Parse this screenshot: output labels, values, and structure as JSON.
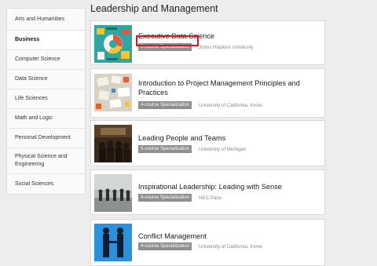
{
  "page": {
    "title": "Leadership and Management"
  },
  "sidebar": {
    "items": [
      {
        "label": "Arts and Humanities",
        "active": false
      },
      {
        "label": "Business",
        "active": true
      },
      {
        "label": "Computer Science",
        "active": false
      },
      {
        "label": "Data Science",
        "active": false
      },
      {
        "label": "Life Sciences",
        "active": false
      },
      {
        "label": "Math and Logic",
        "active": false
      },
      {
        "label": "Personal Development",
        "active": false
      },
      {
        "label": "Physical Science and Engineering",
        "active": false
      },
      {
        "label": "Social Sciences",
        "active": false
      }
    ]
  },
  "courses": [
    {
      "title": "Executive Data Science",
      "badge": "5-course Specialization",
      "partner": "Johns Hopkins University",
      "highlighted": true
    },
    {
      "title": "Introduction to Project Management Principles and Practices",
      "badge": "4-course Specialization",
      "partner": "University of California, Irvine"
    },
    {
      "title": "Leading People and Teams",
      "badge": "5-course Specialization",
      "partner": "University of Michigan"
    },
    {
      "title": "Inspirational Leadership: Leading with Sense",
      "badge": "4-course Specialization",
      "partner": "HEC Paris"
    },
    {
      "title": "Conflict Management",
      "badge": "4-course Specialization",
      "partner": "University of California, Irvine"
    }
  ],
  "colors": {
    "highlight_border": "#d9141b",
    "badge_bg": "#8f8f8f",
    "page_bg": "#ededed"
  },
  "icons": {
    "thumb_1": "data-science-illustration",
    "thumb_2": "project-planning-photo",
    "thumb_3": "conference-photo",
    "thumb_4": "crowd-silhouette-photo",
    "thumb_5": "handshake-silhouette-photo"
  }
}
